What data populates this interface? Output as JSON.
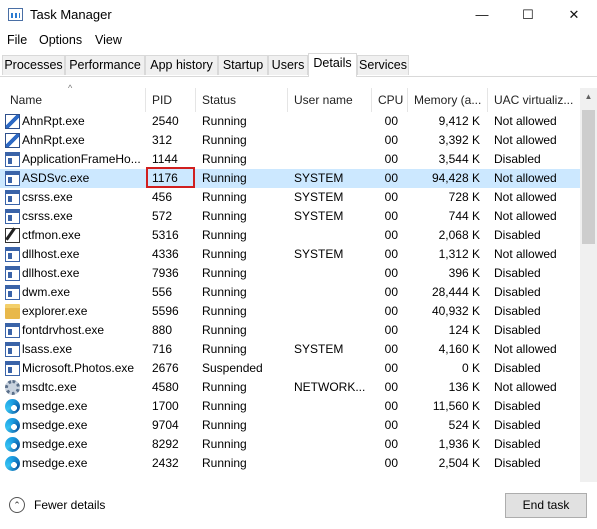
{
  "window": {
    "title": "Task Manager",
    "minimize_glyph": "—",
    "maximize_glyph": "☐",
    "close_glyph": "✕"
  },
  "menu": [
    "File",
    "Options",
    "View"
  ],
  "tabs": [
    {
      "label": "Processes",
      "active": false
    },
    {
      "label": "Performance",
      "active": false
    },
    {
      "label": "App history",
      "active": false
    },
    {
      "label": "Startup",
      "active": false
    },
    {
      "label": "Users",
      "active": false
    },
    {
      "label": "Details",
      "active": true
    },
    {
      "label": "Services",
      "active": false
    }
  ],
  "columns": {
    "name": "Name",
    "pid": "PID",
    "status": "Status",
    "user": "User name",
    "cpu": "CPU",
    "memory": "Memory (a...",
    "uac": "UAC virtualiz..."
  },
  "sort_glyph": "^",
  "rows": [
    {
      "icon": "ahnlab-icon",
      "name": "AhnRpt.exe",
      "pid": "2540",
      "status": "Running",
      "user": "",
      "cpu": "00",
      "memory": "9,412 K",
      "uac": "Not allowed"
    },
    {
      "icon": "ahnlab-icon",
      "name": "AhnRpt.exe",
      "pid": "312",
      "status": "Running",
      "user": "",
      "cpu": "00",
      "memory": "3,392 K",
      "uac": "Not allowed"
    },
    {
      "icon": "window-icon",
      "name": "ApplicationFrameHo...",
      "pid": "1144",
      "status": "Running",
      "user": "",
      "cpu": "00",
      "memory": "3,544 K",
      "uac": "Disabled"
    },
    {
      "icon": "window-icon",
      "name": "ASDSvc.exe",
      "pid": "1176",
      "status": "Running",
      "user": "SYSTEM",
      "cpu": "00",
      "memory": "94,428 K",
      "uac": "Not allowed",
      "selected": true
    },
    {
      "icon": "window-icon",
      "name": "csrss.exe",
      "pid": "456",
      "status": "Running",
      "user": "SYSTEM",
      "cpu": "00",
      "memory": "728 K",
      "uac": "Not allowed"
    },
    {
      "icon": "window-icon",
      "name": "csrss.exe",
      "pid": "572",
      "status": "Running",
      "user": "SYSTEM",
      "cpu": "00",
      "memory": "744 K",
      "uac": "Not allowed"
    },
    {
      "icon": "pen-icon",
      "name": "ctfmon.exe",
      "pid": "5316",
      "status": "Running",
      "user": "",
      "cpu": "00",
      "memory": "2,068 K",
      "uac": "Disabled"
    },
    {
      "icon": "window-icon",
      "name": "dllhost.exe",
      "pid": "4336",
      "status": "Running",
      "user": "SYSTEM",
      "cpu": "00",
      "memory": "1,312 K",
      "uac": "Not allowed"
    },
    {
      "icon": "window-icon",
      "name": "dllhost.exe",
      "pid": "7936",
      "status": "Running",
      "user": "",
      "cpu": "00",
      "memory": "396 K",
      "uac": "Disabled"
    },
    {
      "icon": "window-icon",
      "name": "dwm.exe",
      "pid": "556",
      "status": "Running",
      "user": "",
      "cpu": "00",
      "memory": "28,444 K",
      "uac": "Disabled"
    },
    {
      "icon": "folder-icon",
      "name": "explorer.exe",
      "pid": "5596",
      "status": "Running",
      "user": "",
      "cpu": "00",
      "memory": "40,932 K",
      "uac": "Disabled"
    },
    {
      "icon": "window-icon",
      "name": "fontdrvhost.exe",
      "pid": "880",
      "status": "Running",
      "user": "",
      "cpu": "00",
      "memory": "124 K",
      "uac": "Disabled"
    },
    {
      "icon": "window-icon",
      "name": "lsass.exe",
      "pid": "716",
      "status": "Running",
      "user": "SYSTEM",
      "cpu": "00",
      "memory": "4,160 K",
      "uac": "Not allowed"
    },
    {
      "icon": "window-icon",
      "name": "Microsoft.Photos.exe",
      "pid": "2676",
      "status": "Suspended",
      "user": "",
      "cpu": "00",
      "memory": "0 K",
      "uac": "Disabled"
    },
    {
      "icon": "gear-icon",
      "name": "msdtc.exe",
      "pid": "4580",
      "status": "Running",
      "user": "NETWORK...",
      "cpu": "00",
      "memory": "136 K",
      "uac": "Not allowed"
    },
    {
      "icon": "edge-icon",
      "name": "msedge.exe",
      "pid": "1700",
      "status": "Running",
      "user": "",
      "cpu": "00",
      "memory": "11,560 K",
      "uac": "Disabled"
    },
    {
      "icon": "edge-icon",
      "name": "msedge.exe",
      "pid": "9704",
      "status": "Running",
      "user": "",
      "cpu": "00",
      "memory": "524 K",
      "uac": "Disabled"
    },
    {
      "icon": "edge-icon",
      "name": "msedge.exe",
      "pid": "8292",
      "status": "Running",
      "user": "",
      "cpu": "00",
      "memory": "1,936 K",
      "uac": "Disabled"
    },
    {
      "icon": "edge-icon",
      "name": "msedge.exe",
      "pid": "2432",
      "status": "Running",
      "user": "",
      "cpu": "00",
      "memory": "2,504 K",
      "uac": "Disabled"
    }
  ],
  "highlighted_pid": "1176",
  "footer": {
    "fewer_details_label": "Fewer details",
    "end_task_label": "End task"
  },
  "colors": {
    "selection": "#cce8ff",
    "highlight_box": "#d01f1f"
  }
}
